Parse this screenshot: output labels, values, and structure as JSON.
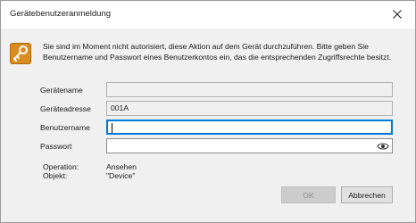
{
  "dialog": {
    "title": "Gerätebenutzeranmeldung",
    "message": "Sie sind im Moment nicht autorisiert, diese Aktion auf dem Gerät durchzuführen. Bitte geben Sie Benutzername und Passwort eines Benutzerkontos ein, das die entsprechenden Zugriffsrechte besitzt.",
    "icon": "key-icon",
    "close_icon": "close-icon"
  },
  "fields": {
    "geraetename": {
      "label": "Gerätename",
      "value": ""
    },
    "geraeteadresse": {
      "label": "Geräteadresse",
      "value": "001A"
    },
    "benutzername": {
      "label": "Benutzername",
      "value": ""
    },
    "passwort": {
      "label": "Passwort",
      "value": "",
      "icon": "eye-icon"
    }
  },
  "info": {
    "operation_label": "Operation:",
    "operation_value": "Ansehen",
    "objekt_label": "Objekt:",
    "objekt_value": "\"Device\""
  },
  "buttons": {
    "ok": "OK",
    "cancel": "Abbrechen"
  },
  "colors": {
    "focus": "#0078d7",
    "key_icon": "#d98c1f"
  }
}
